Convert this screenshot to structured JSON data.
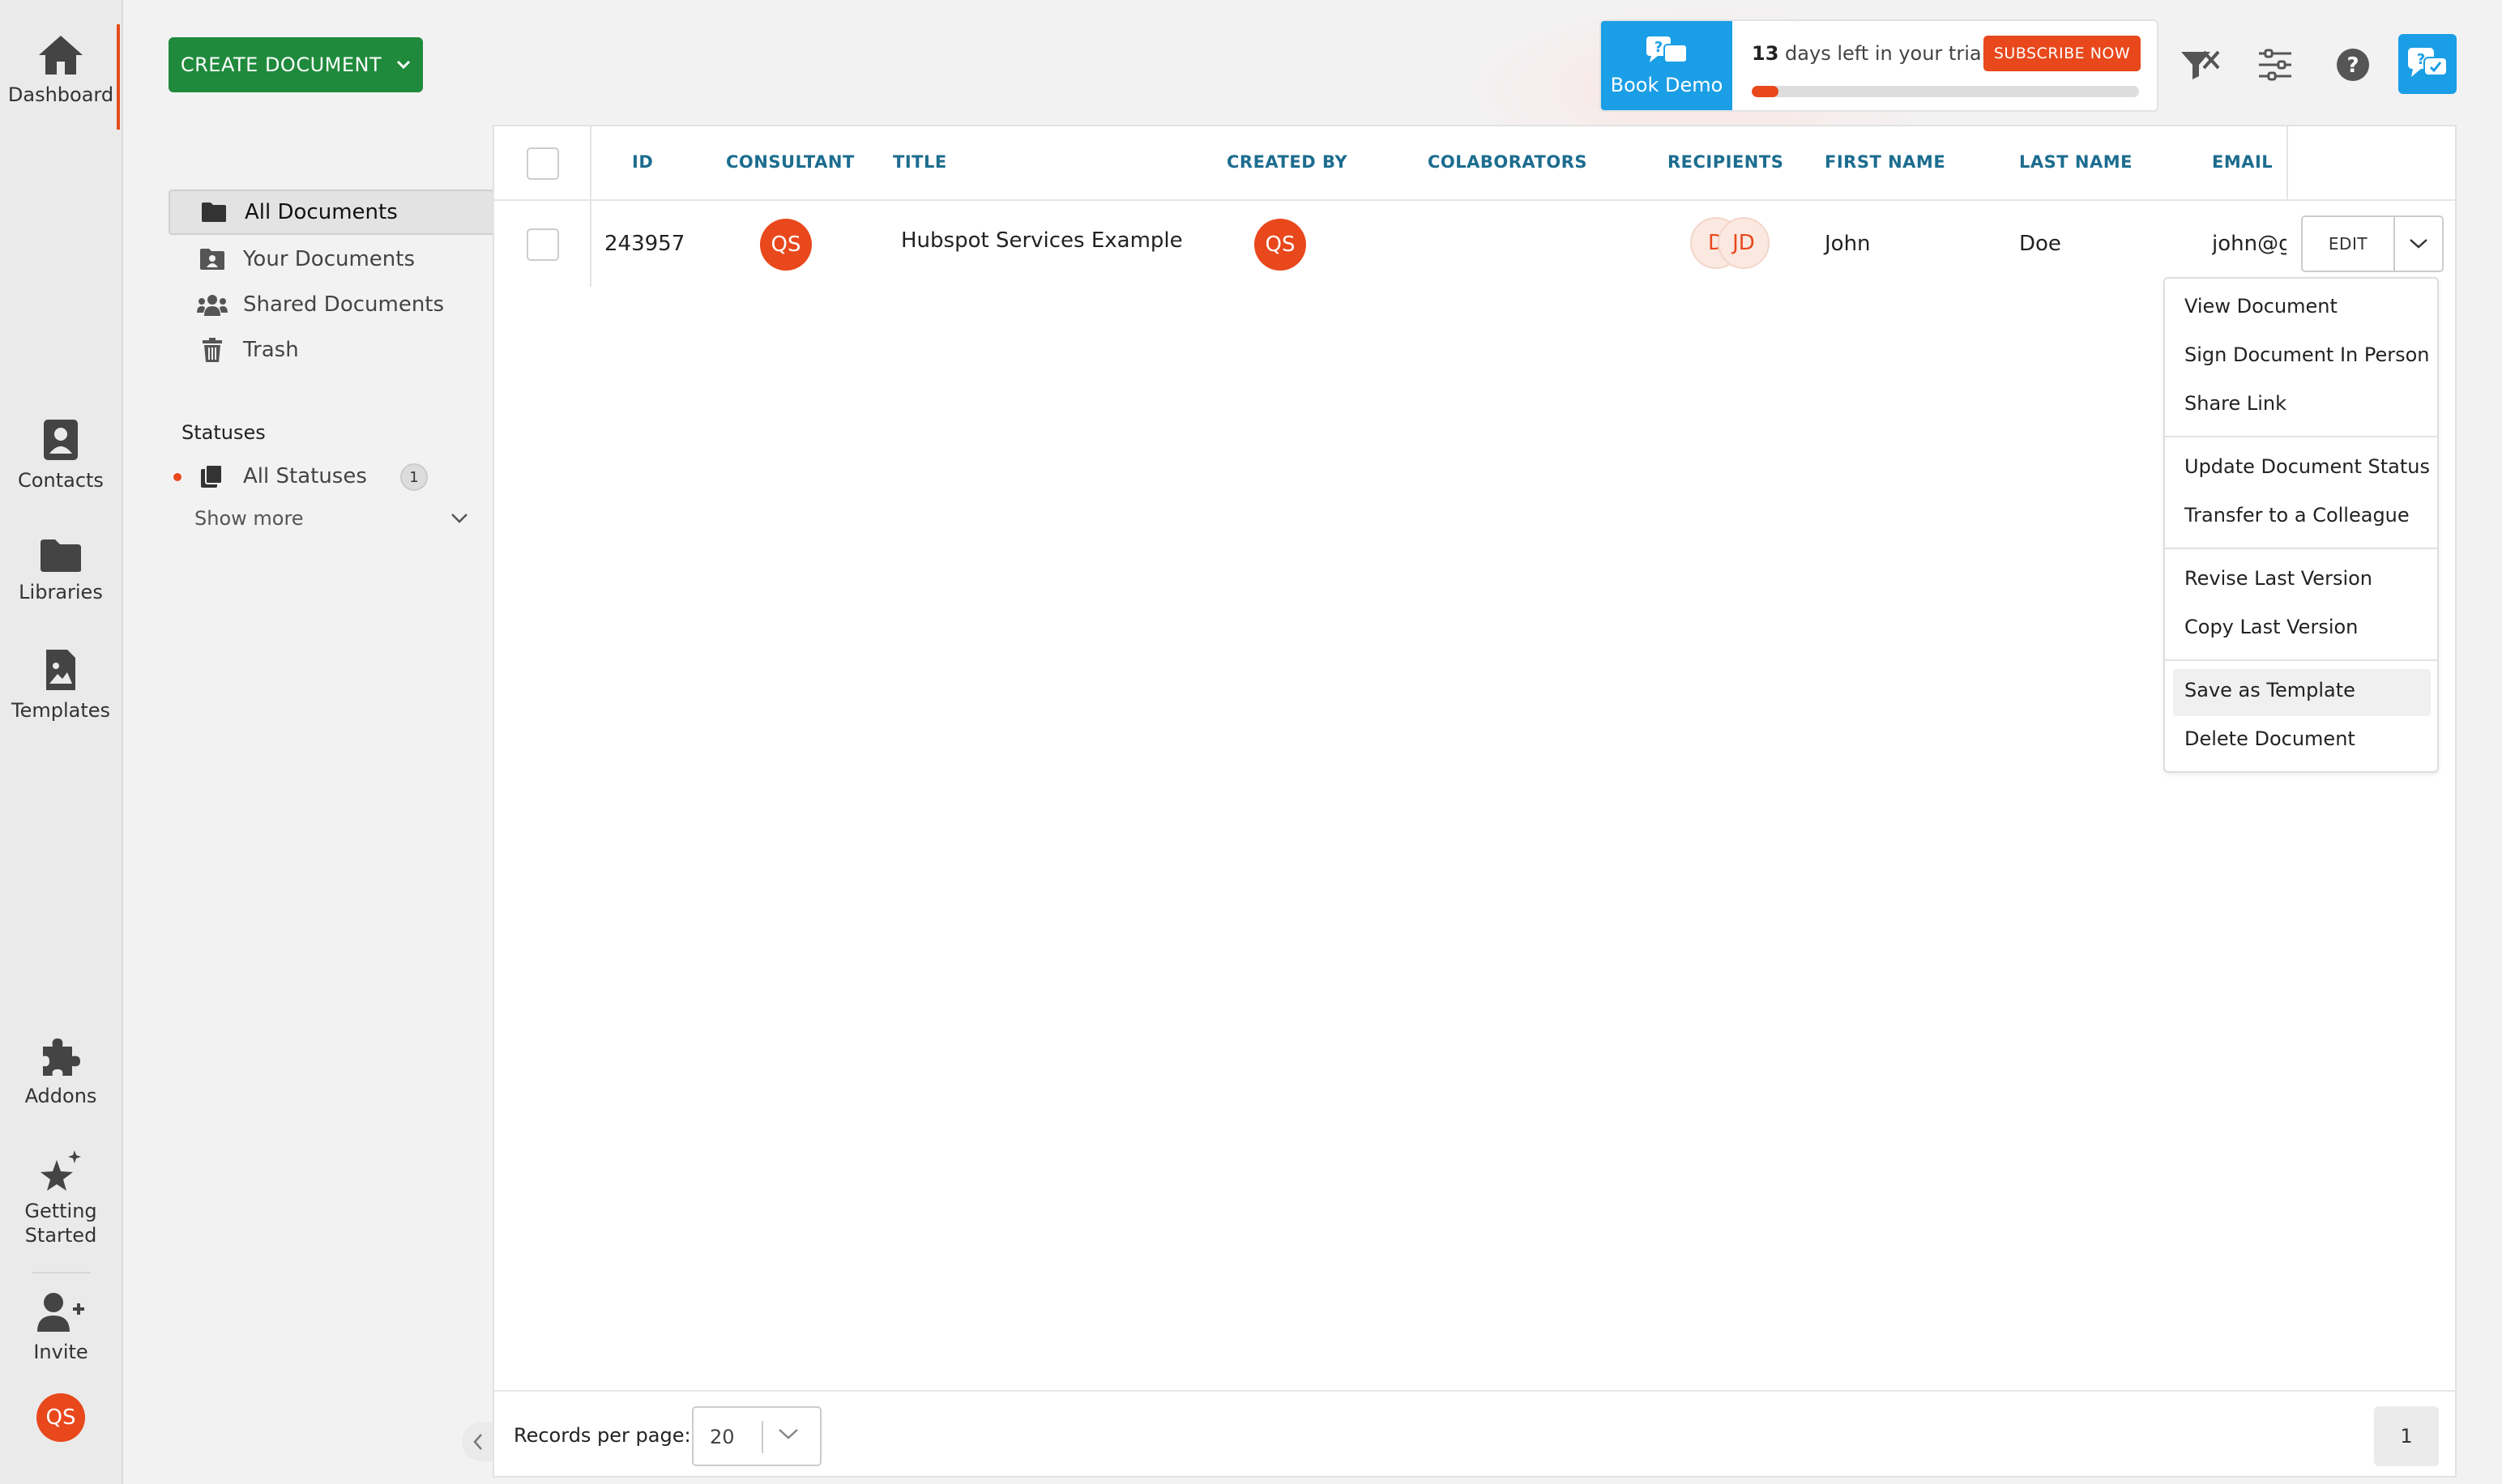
{
  "nav_rail": {
    "items": [
      {
        "label": "Dashboard",
        "icon": "home-icon"
      },
      {
        "label": "Contacts",
        "icon": "contacts-icon"
      },
      {
        "label": "Libraries",
        "icon": "folder-icon"
      },
      {
        "label": "Templates",
        "icon": "template-icon"
      },
      {
        "label": "Addons",
        "icon": "puzzle-icon"
      },
      {
        "label": "Getting Started",
        "icon": "sparkle-star-icon"
      },
      {
        "label": "Invite",
        "icon": "add-user-icon"
      }
    ],
    "user_initials": "QS"
  },
  "header": {
    "create_button": "CREATE DOCUMENT",
    "book_demo": "Book Demo",
    "trial_days": "13",
    "trial_text": "days left in your trial",
    "subscribe": "SUBSCRIBE NOW",
    "trial_progress": 0.07,
    "icons": [
      "filter-icon",
      "sliders-icon",
      "help-icon",
      "chat-support-icon"
    ]
  },
  "sidebar": {
    "items": [
      {
        "label": "All Documents",
        "icon": "folder-icon",
        "active": true
      },
      {
        "label": "Your Documents",
        "icon": "user-folder-icon"
      },
      {
        "label": "Shared Documents",
        "icon": "users-icon"
      },
      {
        "label": "Trash",
        "icon": "trash-icon"
      }
    ],
    "statuses_heading": "Statuses",
    "all_statuses": "All Statuses",
    "all_statuses_count": "1",
    "show_more": "Show more"
  },
  "table": {
    "columns": [
      "ID",
      "CONSULTANT",
      "TITLE",
      "CREATED BY",
      "COLABORATORS",
      "RECIPIENTS",
      "FIRST NAME",
      "LAST NAME",
      "EMAIL"
    ],
    "rows": [
      {
        "id": "243957",
        "consultant": "QS",
        "title": "Hubspot Services Example",
        "created_by": "QS",
        "recipients": [
          "D",
          "JD"
        ],
        "first_name": "John",
        "last_name": "Doe",
        "email": "john@g"
      }
    ],
    "edit_label": "EDIT"
  },
  "dropdown": {
    "items": [
      "View Document",
      "Sign Document In Person",
      "Share Link",
      "Update Document Status",
      "Transfer to a Colleague",
      "Revise Last Version",
      "Copy Last Version",
      "Save as Template",
      "Delete Document"
    ],
    "highlighted": "Save as Template"
  },
  "footer": {
    "records_label": "Records per page:",
    "records_value": "20",
    "page": "1"
  },
  "colors": {
    "brand_green": "#1f8a3c",
    "accent_orange": "#e8481c",
    "header_blue": "#1a9ee6",
    "table_header_text": "#1c6d8f"
  }
}
